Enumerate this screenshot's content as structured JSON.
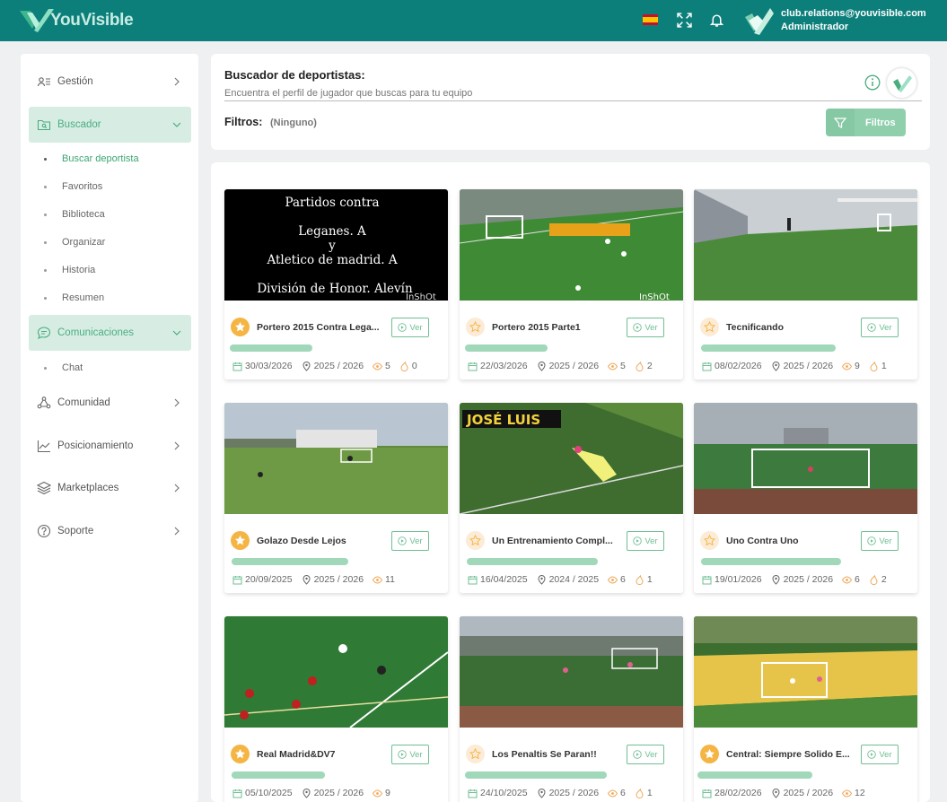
{
  "app": {
    "brand": "YouVisible",
    "user_email": "club.relations@youvisible.com",
    "user_role": "Administrador"
  },
  "sidebar": {
    "items": [
      {
        "label": "Gestión",
        "icon": "users-list-icon"
      },
      {
        "label": "Buscador",
        "icon": "folder-search-icon"
      },
      {
        "label": "Comunicaciones",
        "icon": "chat-bubble-icon"
      },
      {
        "label": "Comunidad",
        "icon": "community-icon"
      },
      {
        "label": "Posicionamiento",
        "icon": "chart-line-icon"
      },
      {
        "label": "Marketplaces",
        "icon": "layers-icon"
      },
      {
        "label": "Soporte",
        "icon": "help-circle-icon"
      }
    ],
    "buscador_sub": [
      "Buscar deportista",
      "Favoritos",
      "Biblioteca",
      "Organizar",
      "Historia",
      "Resumen"
    ],
    "comunicaciones_sub": [
      "Chat"
    ]
  },
  "search": {
    "title": "Buscador de deportistas:",
    "subtitle": "Encuentra el perfil de jugador que buscas para tu equipo",
    "filters_label": "Filtros:",
    "filters_value": "(Ninguno)",
    "filters_button": "Filtros"
  },
  "video_overlay": {
    "lines": [
      "Partidos contra",
      "Leganes.  A",
      "y",
      "Atletico de madrid. A",
      "División de Honor. Alevín"
    ],
    "watermark": "InShOt",
    "banner": "JOSÉ LUIS"
  },
  "cards": [
    {
      "title": "Portero 2015 Contra Lega...",
      "starred": true,
      "ver": "Ver",
      "date": "30/03/2026",
      "season": "2025 / 2026",
      "views": "5",
      "likes": "0"
    },
    {
      "title": "Portero 2015 Parte1",
      "starred": false,
      "ver": "Ver",
      "date": "22/03/2026",
      "season": "2025 / 2026",
      "views": "5",
      "likes": "2"
    },
    {
      "title": "Tecnificando",
      "starred": false,
      "ver": "Ver",
      "date": "08/02/2026",
      "season": "2025 / 2026",
      "views": "9",
      "likes": "1"
    },
    {
      "title": "Golazo Desde Lejos",
      "starred": true,
      "ver": "Ver",
      "date": "20/09/2025",
      "season": "2025 / 2026",
      "views": "11",
      "likes": ""
    },
    {
      "title": "Un Entrenamiento Compl...",
      "starred": false,
      "ver": "Ver",
      "date": "16/04/2025",
      "season": "2024 / 2025",
      "views": "6",
      "likes": "1"
    },
    {
      "title": "Uno Contra Uno",
      "starred": false,
      "ver": "Ver",
      "date": "19/01/2026",
      "season": "2025 / 2026",
      "views": "6",
      "likes": "2"
    },
    {
      "title": "Real Madrid&DV7",
      "starred": true,
      "ver": "Ver",
      "date": "05/10/2025",
      "season": "2025 / 2026",
      "views": "9",
      "likes": ""
    },
    {
      "title": "Los Penaltis Se Paran!!",
      "starred": false,
      "ver": "Ver",
      "date": "24/10/2025",
      "season": "2025 / 2026",
      "views": "6",
      "likes": "1"
    },
    {
      "title": "Central: Siempre Solido E...",
      "starred": true,
      "ver": "Ver",
      "date": "28/02/2026",
      "season": "2025 / 2026",
      "views": "12",
      "likes": ""
    }
  ],
  "colors": {
    "topbar": "#0d7f7b",
    "accent": "#4aad80",
    "star_on": "#f5b544"
  }
}
